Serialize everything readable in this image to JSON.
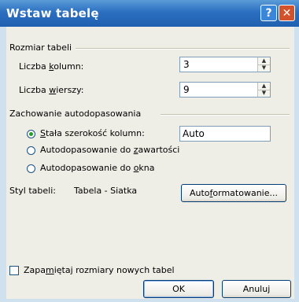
{
  "window": {
    "title": "Wstaw tabelę",
    "help_glyph": "?",
    "close_glyph": "✕"
  },
  "table_size": {
    "group_label": "Rozmiar tabeli",
    "columns_label_pre": "Liczba ",
    "columns_label_key": "k",
    "columns_label_post": "olumn:",
    "columns_value": "3",
    "rows_label_pre": "Liczba ",
    "rows_label_key": "w",
    "rows_label_post": "ierszy:",
    "rows_value": "9"
  },
  "autofit": {
    "group_label": "Zachowanie autodopasowania",
    "fixed_pre": "",
    "fixed_key": "S",
    "fixed_post": "tała szerokość kolumn:",
    "fixed_value": "Auto",
    "contents_pre": "Autodopasowanie do ",
    "contents_key": "z",
    "contents_post": "awartości",
    "window_pre": "Autodopasowanie do ",
    "window_key": "o",
    "window_post": "kna",
    "selected": "fixed"
  },
  "style": {
    "label": "Styl tabeli:",
    "value": "Tabela - Siatka",
    "autoformat_pre": "Auto",
    "autoformat_key": "f",
    "autoformat_post": "ormatowanie..."
  },
  "remember": {
    "pre": "Zapa",
    "key": "m",
    "post": "iętaj rozmiary nowych tabel",
    "checked": false
  },
  "buttons": {
    "ok": "OK",
    "cancel": "Anuluj"
  }
}
